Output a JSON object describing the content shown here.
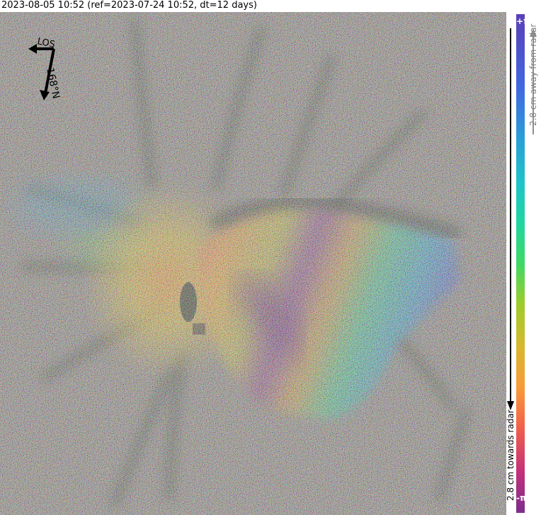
{
  "title": "2023-08-05 10:52 (ref=2023-07-24 10:52, dt=12 days)",
  "compass": {
    "los_label": "LOS",
    "heading_label": "168°N"
  },
  "colorbar": {
    "top_label": "+π",
    "bottom_label": "-π",
    "away_label": "2.8 cm away from radar",
    "towards_label": "2.8 cm towards radar",
    "colors": [
      "#7b2d8e",
      "#f0604a",
      "#d9b72f",
      "#3fd866",
      "#1fc4c8",
      "#4169e1"
    ]
  }
}
